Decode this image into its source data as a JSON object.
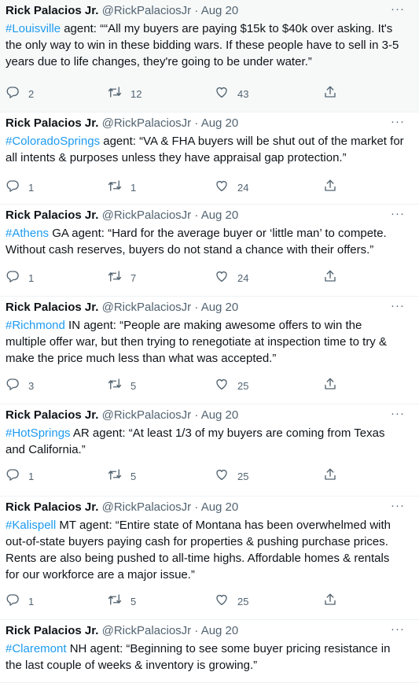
{
  "tweets": [
    {
      "name": "Rick Palacios Jr.",
      "handle": "@RickPalaciosJr",
      "date": "Aug 20",
      "hashtag": "#Louisville",
      "text": " agent: ““All my buyers are paying $15k to $40k over asking. It's the only way to win in these bidding wars. If these people have to sell in 3-5 years due to life changes, they're going to be under water.”",
      "replies": "2",
      "retweets": "12",
      "likes": "43"
    },
    {
      "name": "Rick Palacios Jr.",
      "handle": "@RickPalaciosJr",
      "date": "Aug 20",
      "hashtag": "#ColoradoSprings",
      "text": " agent: “VA & FHA buyers will be shut out of the market for all intents & purposes unless they have appraisal gap protection.”",
      "replies": "1",
      "retweets": "1",
      "likes": "24"
    },
    {
      "name": "Rick Palacios Jr.",
      "handle": "@RickPalaciosJr",
      "date": "Aug 20",
      "hashtag": "#Athens",
      "text": " GA agent: “Hard for the average buyer or ‘little man’ to compete. Without cash reserves, buyers do not stand a chance with their offers.”",
      "replies": "1",
      "retweets": "7",
      "likes": "24"
    },
    {
      "name": "Rick Palacios Jr.",
      "handle": "@RickPalaciosJr",
      "date": "Aug 20",
      "hashtag": "#Richmond",
      "text": " IN agent: “People are making awesome offers to win the multiple offer war, but then trying to renegotiate at inspection time to try & make the price much less than what was accepted.”",
      "replies": "3",
      "retweets": "5",
      "likes": "25"
    },
    {
      "name": "Rick Palacios Jr.",
      "handle": "@RickPalaciosJr",
      "date": "Aug 20",
      "hashtag": "#HotSprings",
      "text": " AR agent: “At least 1/3 of my buyers are coming from Texas and California.”",
      "replies": "1",
      "retweets": "5",
      "likes": "25"
    },
    {
      "name": "Rick Palacios Jr.",
      "handle": "@RickPalaciosJr",
      "date": "Aug 20",
      "hashtag": "#Kalispell",
      "text": " MT agent: “Entire state of Montana has been overwhelmed with out-of-state buyers paying cash for properties & pushing purchase prices. Rents are also being pushed to all-time highs. Affordable homes & rentals for our workforce are a major issue.”",
      "replies": "1",
      "retweets": "5",
      "likes": "25"
    },
    {
      "name": "Rick Palacios Jr.",
      "handle": "@RickPalaciosJr",
      "date": "Aug 20",
      "hashtag": "#Claremont",
      "text": " NH agent: “Beginning to see some buyer pricing resistance in the last couple of weeks & inventory is growing.”",
      "replies": null,
      "retweets": null,
      "likes": null
    }
  ],
  "labels": {
    "separator": "·",
    "more": "···"
  },
  "colors": {
    "accent": "#1d9bf0",
    "muted": "#536471",
    "text": "#0f1419"
  },
  "icons": [
    "reply-icon",
    "retweet-icon",
    "like-icon",
    "share-icon",
    "more-icon"
  ]
}
